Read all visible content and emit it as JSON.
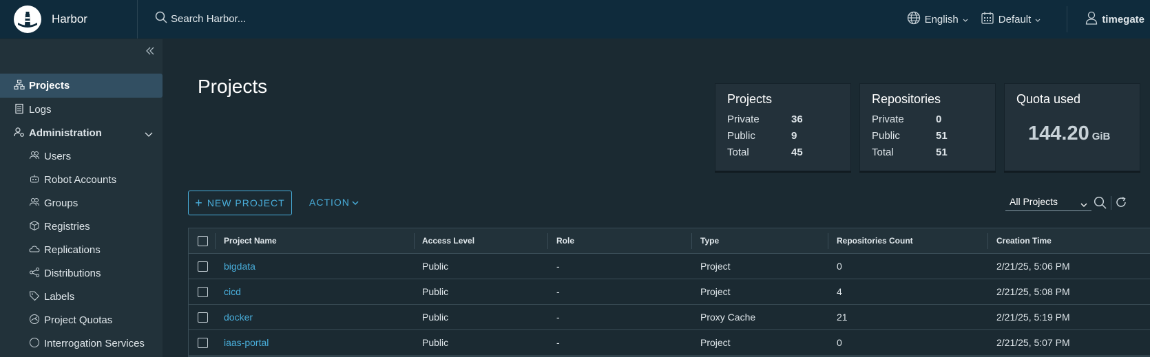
{
  "header": {
    "brand": "Harbor",
    "search_placeholder": "Search Harbor...",
    "language": "English",
    "theme": "Default",
    "user": "timegate"
  },
  "sidebar": {
    "items": [
      {
        "label": "Projects",
        "icon": "projects-icon",
        "active": true
      },
      {
        "label": "Logs",
        "icon": "logs-icon"
      },
      {
        "label": "Administration",
        "icon": "administration-icon"
      },
      {
        "label": "Users",
        "icon": "users-icon"
      },
      {
        "label": "Robot Accounts",
        "icon": "robot-icon"
      },
      {
        "label": "Groups",
        "icon": "groups-icon"
      },
      {
        "label": "Registries",
        "icon": "registries-icon"
      },
      {
        "label": "Replications",
        "icon": "replications-icon"
      },
      {
        "label": "Distributions",
        "icon": "distributions-icon"
      },
      {
        "label": "Labels",
        "icon": "labels-icon"
      },
      {
        "label": "Project Quotas",
        "icon": "quotas-icon"
      },
      {
        "label": "Interrogation Services",
        "icon": "interrogation-icon"
      }
    ]
  },
  "main": {
    "title": "Projects",
    "cards": {
      "projects": {
        "title": "Projects",
        "private_label": "Private",
        "private": "36",
        "public_label": "Public",
        "public": "9",
        "total_label": "Total",
        "total": "45"
      },
      "repositories": {
        "title": "Repositories",
        "private_label": "Private",
        "private": "0",
        "public_label": "Public",
        "public": "51",
        "total_label": "Total",
        "total": "51"
      },
      "quota": {
        "title": "Quota used",
        "value": "144.20",
        "unit": "GiB"
      }
    },
    "new_project_label": "NEW PROJECT",
    "action_label": "ACTION",
    "filter_value": "All Projects",
    "table": {
      "columns": [
        "Project Name",
        "Access Level",
        "Role",
        "Type",
        "Repositories Count",
        "Creation Time"
      ],
      "rows": [
        [
          "bigdata",
          "Public",
          "-",
          "Project",
          "0",
          "2/21/25, 5:06 PM"
        ],
        [
          "cicd",
          "Public",
          "-",
          "Project",
          "4",
          "2/21/25, 5:08 PM"
        ],
        [
          "docker",
          "Public",
          "-",
          "Proxy Cache",
          "21",
          "2/21/25, 5:19 PM"
        ],
        [
          "iaas-portal",
          "Public",
          "-",
          "Project",
          "0",
          "2/21/25, 5:07 PM"
        ]
      ]
    }
  },
  "colors": {
    "header_bg": "#0f2b3c",
    "sidebar_bg": "#22323a",
    "main_bg": "#1b2a32",
    "accent": "#49aedb",
    "active_nav": "#324f62"
  }
}
